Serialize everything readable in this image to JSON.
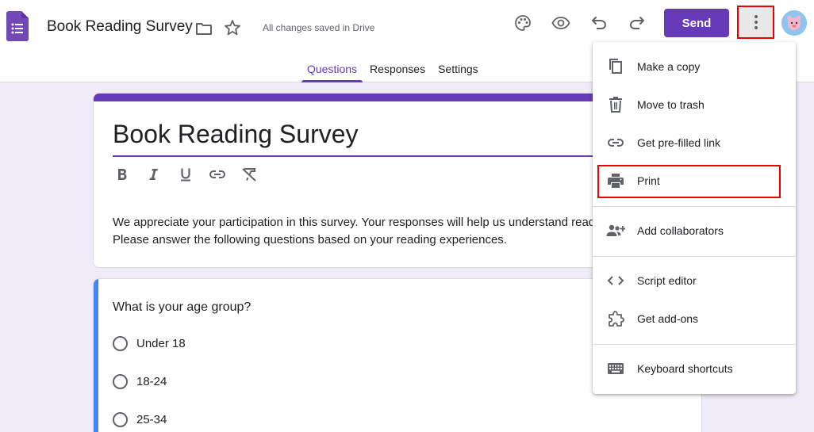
{
  "header": {
    "doc_title": "Book Reading Survey",
    "save_status": "All changes saved in Drive",
    "send_label": "Send",
    "tabs": [
      {
        "label": "Questions",
        "active": true
      },
      {
        "label": "Responses",
        "active": false
      },
      {
        "label": "Settings",
        "active": false
      }
    ]
  },
  "form": {
    "title": "Book Reading Survey",
    "description": "We appreciate your participation in this survey. Your responses will help us understand reading preferences. Please answer the following questions based on your reading experiences.",
    "toolbar": [
      "bold-icon",
      "italic-icon",
      "underline-icon",
      "link-icon",
      "clear-format-icon"
    ]
  },
  "question": {
    "title": "What is your age group?",
    "options": [
      "Under 18",
      "18-24",
      "25-34"
    ]
  },
  "menu": {
    "items": [
      {
        "label": "Make a copy",
        "icon": "copy-icon"
      },
      {
        "label": "Move to trash",
        "icon": "trash-icon"
      },
      {
        "label": "Get pre-filled link",
        "icon": "link-icon"
      },
      {
        "label": "Print",
        "icon": "print-icon"
      },
      {
        "label": "Add collaborators",
        "icon": "add-people-icon"
      },
      {
        "label": "Script editor",
        "icon": "code-icon"
      },
      {
        "label": "Get add-ons",
        "icon": "puzzle-icon"
      },
      {
        "label": "Keyboard shortcuts",
        "icon": "keyboard-icon"
      }
    ]
  },
  "colors": {
    "accent": "#673ab7",
    "question_bar": "#4285f4",
    "background": "#f0ebf8",
    "highlight": "#ee0000"
  }
}
